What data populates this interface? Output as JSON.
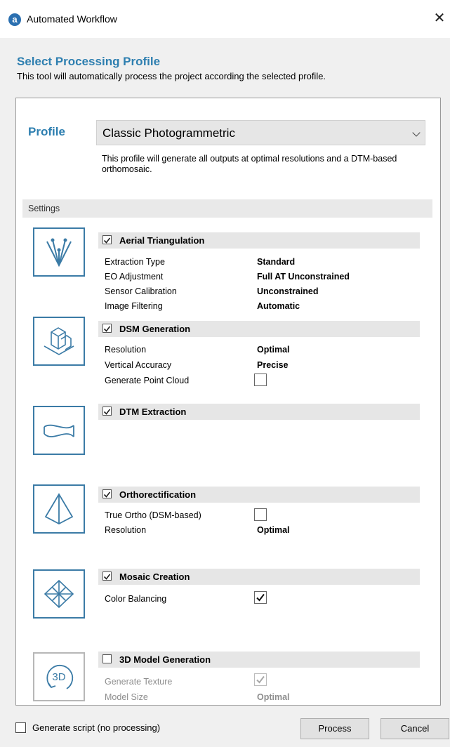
{
  "window": {
    "title": "Automated Workflow",
    "close_glyph": "✕",
    "app_icon_glyph": "a"
  },
  "header": {
    "title": "Select Processing Profile",
    "subtitle": "This tool will automatically process the project according the selected profile."
  },
  "profile": {
    "label": "Profile",
    "selected": "Classic Photogrammetric",
    "description": "This profile will generate all outputs at optimal resolutions and a DTM-based orthomosaic."
  },
  "settings_label": "Settings",
  "sections": {
    "aerial_triangulation": {
      "title": "Aerial Triangulation",
      "checked": true,
      "icon": "triangulation-icon",
      "rows": [
        {
          "label": "Extraction Type",
          "value": "Standard"
        },
        {
          "label": "EO Adjustment",
          "value": "Full AT Unconstrained"
        },
        {
          "label": "Sensor Calibration",
          "value": "Unconstrained"
        },
        {
          "label": "Image Filtering",
          "value": "Automatic"
        }
      ]
    },
    "dsm_generation": {
      "title": "DSM Generation",
      "checked": true,
      "icon": "buildings-icon",
      "rows": [
        {
          "label": "Resolution",
          "value": "Optimal"
        },
        {
          "label": "Vertical Accuracy",
          "value": "Precise"
        },
        {
          "label": "Generate Point Cloud",
          "checked": false
        }
      ]
    },
    "dtm_extraction": {
      "title": "DTM Extraction",
      "checked": true,
      "icon": "terrain-icon"
    },
    "orthorectification": {
      "title": "Orthorectification",
      "checked": true,
      "icon": "pyramid-icon",
      "rows": [
        {
          "label": "True Ortho (DSM-based)",
          "checked": false
        },
        {
          "label": "Resolution",
          "value": "Optimal"
        }
      ]
    },
    "mosaic_creation": {
      "title": "Mosaic Creation",
      "checked": true,
      "icon": "mosaic-icon",
      "rows": [
        {
          "label": "Color Balancing",
          "checked": true
        }
      ]
    },
    "model_3d": {
      "title": "3D Model Generation",
      "checked": false,
      "icon": "3d-rotate-icon",
      "icon_text": "3D",
      "rows": [
        {
          "label": "Generate Texture",
          "checked": true,
          "disabled": true
        },
        {
          "label": "Model Size",
          "value": "Optimal",
          "disabled": true
        }
      ]
    }
  },
  "footer": {
    "generate_script_label": "Generate script (no processing)",
    "generate_script_checked": false,
    "process_label": "Process",
    "cancel_label": "Cancel"
  },
  "colors": {
    "accent": "#2e7fb0",
    "icon_border": "#3b7ba6",
    "section_bg": "#e6e6e6"
  }
}
